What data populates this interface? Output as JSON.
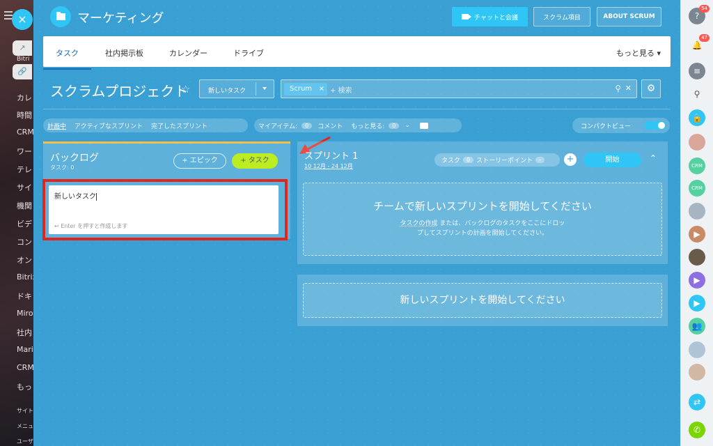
{
  "leftbar": {
    "items": [
      "Bitri",
      "カレ",
      "時間",
      "CRM",
      "ワー",
      "テレ",
      "サイ",
      "機関",
      "ビデ",
      "コン",
      "オン",
      "Bitrix",
      "ドキ",
      "Miro",
      "社内",
      "Mari",
      "CRM",
      "もっ"
    ],
    "footer": [
      "サイト",
      "メニュ",
      "ユーザ"
    ],
    "close": "×"
  },
  "header": {
    "title": "マーケティング",
    "video_button": "チャットと会議",
    "scrum_items_button": "スクラム項目",
    "about_button": "ABOUT SCRUM"
  },
  "tabs": {
    "items": [
      "タスク",
      "社内掲示板",
      "カレンダー",
      "ドライブ"
    ],
    "more": "もっと見る ▾"
  },
  "project": {
    "title": "スクラムプロジェクト",
    "new_task_button": "新しいタスク",
    "search_chip": "Scrum",
    "search_placeholder": "+ 検索"
  },
  "filters": {
    "group1": [
      "計画中",
      "アクティブなスプリント",
      "完了したスプリント"
    ],
    "my_items": "マイアイテム:",
    "comments_count": "0",
    "comments": "コメント",
    "more": "もっと見る:",
    "more_count": "0",
    "more_chevron": "⌄",
    "compact_view": "コンパクトビュー"
  },
  "backlog": {
    "title": "バックログ",
    "subtitle": "タスク: 0",
    "epic_button": "+ エピック",
    "task_button": "+ タスク",
    "input_value": "新しいタスク",
    "input_hint": "↩ Enter を押すと作成します"
  },
  "sprint": {
    "title": "スプリント 1",
    "dates": "10 12月 - 24 12月",
    "tasks_label": "タスク",
    "tasks_count": "0",
    "story_points_label": "ストーリーポイント",
    "story_points_value": "-",
    "start_button": "開始",
    "drop_title": "チームで新しいスプリントを開始してください",
    "drop_link": "タスクの作成",
    "drop_desc_1": " または、バックログのタスクをここにドロッ",
    "drop_desc_2": "プしてスプリントの計画を開始してください。",
    "new_sprint": "新しいスプリントを開始してください"
  },
  "rightbar": {
    "help_badge": "54",
    "notif_badge": "47"
  }
}
